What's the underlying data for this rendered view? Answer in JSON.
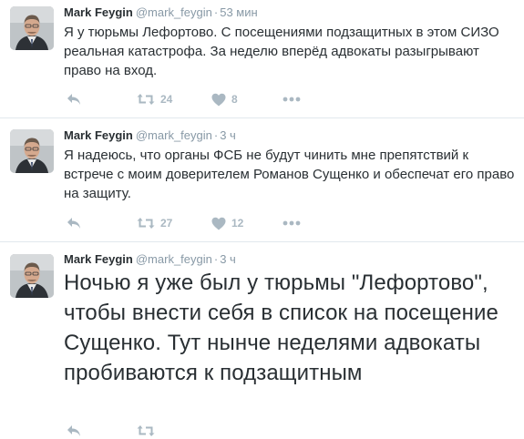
{
  "colors": {
    "name": "#292f33",
    "meta": "#8899a6",
    "action_icon": "#aab8c2",
    "divider": "#e1e8ed"
  },
  "tweets": [
    {
      "author": "Mark Feygin",
      "handle": "@mark_feygin",
      "separator": "·",
      "time": "53 мин",
      "text": "Я у тюрьмы Лефортово. С посещениями подзащитных в этом СИЗО реальная катастрофа. За неделю вперёд адвокаты разыгрывают право на вход.",
      "retweets": "24",
      "likes": "8"
    },
    {
      "author": "Mark Feygin",
      "handle": "@mark_feygin",
      "separator": "·",
      "time": "3 ч",
      "text": "Я надеюсь, что органы ФСБ не будут чинить мне препятствий к встрече с моим доверителем Романов Сущенко и обеспечат его право на защиту.",
      "retweets": "27",
      "likes": "12"
    },
    {
      "author": "Mark Feygin",
      "handle": "@mark_feygin",
      "separator": "·",
      "time": "3 ч",
      "text": "Ночью я уже был у тюрьмы \"Лефортово\", чтобы внести себя в список на посещение Сущенко. Тут нынче неделями адвокаты пробиваются к подзащитным"
    }
  ],
  "icons": {
    "reply": "reply-icon",
    "retweet": "retweet-icon",
    "like": "heart-icon",
    "more": "more-dots-icon",
    "avatar": "avatar"
  }
}
